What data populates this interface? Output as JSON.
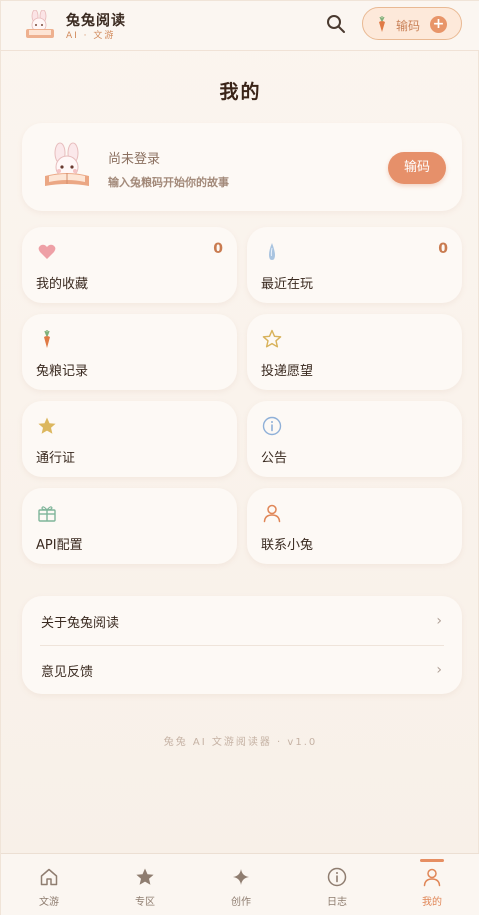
{
  "header": {
    "app_name": "兔兔阅读",
    "app_sub": "AI · 文游",
    "code_label": "输码"
  },
  "page_title": "我的",
  "profile": {
    "name": "尚未登录",
    "hint": "输入兔粮码开始你的故事",
    "button": "输码"
  },
  "grid": [
    {
      "label": "我的收藏",
      "count": "0",
      "icon": "heart-icon",
      "color": "#e89aa0"
    },
    {
      "label": "最近在玩",
      "count": "0",
      "icon": "drop-icon",
      "color": "#9ab8d8"
    },
    {
      "label": "兔粮记录",
      "icon": "carrot-icon",
      "color": "#e07a45"
    },
    {
      "label": "投递愿望",
      "icon": "star-outline-icon",
      "color": "#d8b25a"
    },
    {
      "label": "通行证",
      "icon": "star-icon",
      "color": "#d9b45a"
    },
    {
      "label": "公告",
      "icon": "info-icon",
      "color": "#8fb0d8"
    },
    {
      "label": "API配置",
      "icon": "gift-icon",
      "color": "#7fb59a"
    },
    {
      "label": "联系小兔",
      "icon": "person-icon",
      "color": "#e08657"
    }
  ],
  "links": [
    {
      "label": "关于兔兔阅读"
    },
    {
      "label": "意见反馈"
    }
  ],
  "footer_note": "兔兔 AI 文游阅读器 · v1.0",
  "tabs": [
    {
      "label": "文游",
      "icon": "home-icon"
    },
    {
      "label": "专区",
      "icon": "star-icon"
    },
    {
      "label": "创作",
      "icon": "sparkle-icon"
    },
    {
      "label": "日志",
      "icon": "info-icon"
    },
    {
      "label": "我的",
      "icon": "person-icon",
      "active": true
    }
  ],
  "colors": {
    "accent": "#e68e62",
    "background": "#f8f1ea",
    "card": "#fdf9f5"
  }
}
